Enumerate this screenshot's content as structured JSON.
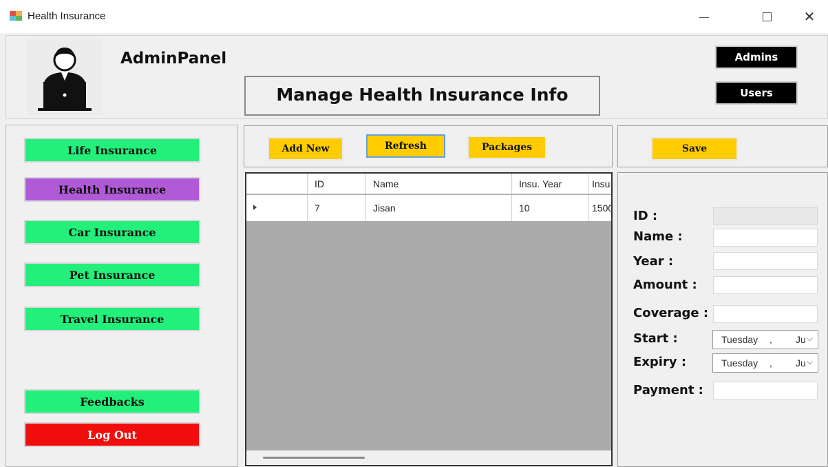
{
  "window": {
    "title": "Health Insurance"
  },
  "header": {
    "admin_title": "AdminPanel",
    "page_heading": "Manage Health Insurance Info",
    "admins_label": "Admins",
    "users_label": "Users"
  },
  "sidebar": {
    "items": [
      {
        "label": "Life Insurance",
        "color": "#22f07a"
      },
      {
        "label": "Health Insurance",
        "color": "#b05ad8",
        "active": true
      },
      {
        "label": "Car Insurance",
        "color": "#22f07a"
      },
      {
        "label": "Pet Insurance",
        "color": "#22f07a"
      },
      {
        "label": "Travel Insurance",
        "color": "#22f07a"
      },
      {
        "label": "Feedbacks",
        "color": "#22f07a"
      },
      {
        "label": "Log Out",
        "color": "#f20d0d"
      }
    ]
  },
  "toolbar": {
    "add_new_label": "Add New",
    "refresh_label": "Refresh",
    "packages_label": "Packages",
    "save_label": "Save",
    "button_color": "#ffcc00"
  },
  "grid": {
    "columns": [
      "",
      "ID",
      "Name",
      "Insu. Year",
      "Insu"
    ],
    "rows": [
      [
        "",
        "7",
        "Jisan",
        "10",
        "1500"
      ]
    ]
  },
  "form": {
    "id_label": "ID :",
    "name_label": "Name :",
    "year_label": "Year :",
    "amount_label": "Amount :",
    "coverage_label": "Coverage :",
    "start_label": "Start :",
    "expiry_label": "Expiry :",
    "payment_label": "Payment :",
    "start_date": {
      "day": "Tuesday",
      "sep": ",",
      "month": "Ju"
    },
    "expiry_date": {
      "day": "Tuesday",
      "sep": ",",
      "month": "Ju"
    }
  }
}
